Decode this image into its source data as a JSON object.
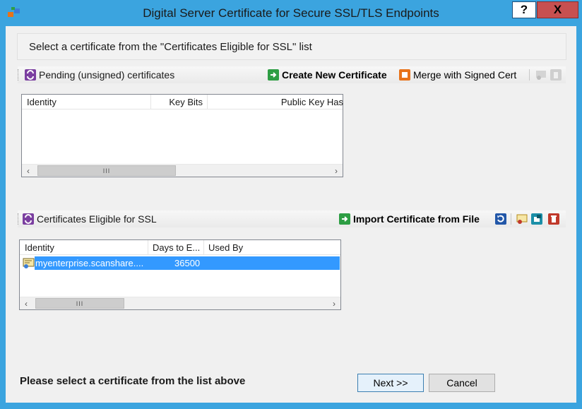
{
  "window": {
    "title": "Digital Server Certificate for Secure SSL/TLS Endpoints",
    "help_label": "?",
    "close_label": "X"
  },
  "banner": {
    "text": "Select a certificate from the \"Certificates Eligible for SSL\" list"
  },
  "pending": {
    "title": "Pending (unsigned) certificates",
    "create_label": "Create New Certificate",
    "merge_label": "Merge with Signed Cert",
    "columns": [
      "Identity",
      "Key Bits",
      "Public Key Has"
    ]
  },
  "eligible": {
    "title": "Certificates Eligible for SSL",
    "import_label": "Import Certificate from File",
    "columns": [
      "Identity",
      "Days to E...",
      "Used By"
    ],
    "rows": [
      {
        "identity": "myenterprise.scanshare....",
        "days": "36500",
        "used_by": ""
      }
    ]
  },
  "scroll_grip": "III",
  "status": {
    "text": "Please select a certificate from the list above"
  },
  "buttons": {
    "next": "Next >>",
    "cancel": "Cancel"
  },
  "colors": {
    "frame": "#3ba4df",
    "selection": "#3399ff",
    "close": "#c75050",
    "icon_purple": "#7b3fa0",
    "icon_green": "#2e9e44",
    "icon_orange": "#e8731a",
    "icon_teal": "#1b8fa8",
    "icon_red": "#c0392b"
  }
}
